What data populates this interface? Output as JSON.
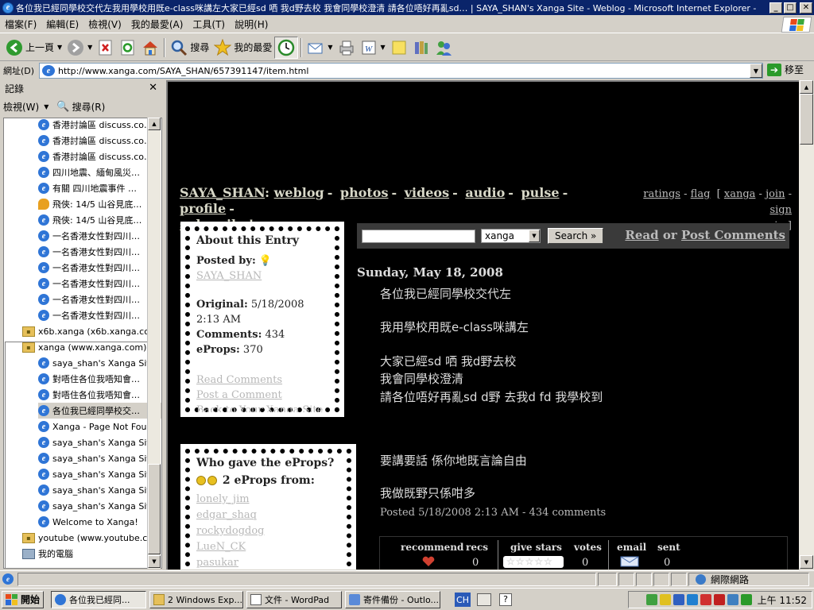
{
  "window": {
    "title": "各位我已經同學校交代左我用學校用既e-class咪講左大家已經sd 哂 我d野去校 我會同學校澄清 請各位唔好再亂sd… | SAYA_SHAN's Xanga Site - Weblog - Microsoft Internet Explorer -",
    "min": "_",
    "max": "□",
    "close": "✕"
  },
  "menu": [
    "檔案(F)",
    "編輯(E)",
    "檢視(V)",
    "我的最愛(A)",
    "工具(T)",
    "說明(H)"
  ],
  "toolbar": {
    "back": "上一頁",
    "search": "搜尋",
    "favorites": "我的最愛"
  },
  "address": {
    "label": "網址(D)",
    "url": "http://www.xanga.com/SAYA_SHAN/657391147/item.html",
    "go": "移至"
  },
  "sidebar": {
    "title": "記錄",
    "view": "檢視(W)",
    "search": "搜尋(R)",
    "items": [
      {
        "text": "香港討論區 discuss.co…",
        "icon": "ie"
      },
      {
        "text": "香港討論區 discuss.co…",
        "icon": "ie"
      },
      {
        "text": "香港討論區 discuss.co…",
        "icon": "ie"
      },
      {
        "text": "四川地震、緬甸風災…",
        "icon": "ie"
      },
      {
        "text": "有關 四川地震事件 …",
        "icon": "ie"
      },
      {
        "text": "飛俠: 14/5 山谷見底…",
        "icon": "chat"
      },
      {
        "text": "飛俠: 14/5 山谷見底…",
        "icon": "ie"
      },
      {
        "text": "一名香港女性對四川…",
        "icon": "ie"
      },
      {
        "text": "一名香港女性對四川…",
        "icon": "ie"
      },
      {
        "text": "一名香港女性對四川…",
        "icon": "ie"
      },
      {
        "text": "一名香港女性對四川…",
        "icon": "ie"
      },
      {
        "text": "一名香港女性對四川…",
        "icon": "ie"
      },
      {
        "text": "一名香港女性對四川…",
        "icon": "ie"
      }
    ],
    "folder1": "x6b.xanga (x6b.xanga.com)",
    "folder2": "xanga (www.xanga.com)",
    "sub": [
      "saya_shan's Xanga Site",
      "對唔住各位我唔知會…",
      "對唔住各位我唔知會…",
      "各位我已經同學校交…",
      "Xanga - Page Not Found",
      "saya_shan's Xanga Site",
      "saya_shan's Xanga Site",
      "saya_shan's Xanga Site",
      "saya_shan's Xanga Site",
      "saya_shan's Xanga Site",
      "Welcome to Xanga!"
    ],
    "folder3": "youtube (www.youtube.com)",
    "mycomputer": "我的電腦"
  },
  "page": {
    "user": "SAYA_SHAN",
    "nav": [
      "weblog",
      "photos",
      "videos",
      "audio",
      "pulse",
      "profile"
    ],
    "subscribe": "subscribe!",
    "right": {
      "ratings": "ratings",
      "flag": "flag",
      "xanga": "xanga",
      "join": "join",
      "sign": "sign",
      "in": "in"
    },
    "about": {
      "title": "About this Entry",
      "posted_by_label": "Posted by:",
      "posted_by": "SAYA_SHAN",
      "original_label": "Original:",
      "original": "5/18/2008 2:13 AM",
      "comments_label": "Comments:",
      "comments": "434",
      "eprops_label": "eProps:",
      "eprops": "370",
      "links": [
        "Read Comments",
        "Post a Comment",
        "Back to Your Xanga Site"
      ]
    },
    "eprops_box": {
      "title": "Who gave the eProps?",
      "count_text": "2 eProps from:",
      "users": [
        "lonely_jim",
        "edgar_shaq",
        "rockydogdog",
        "LueN_CK",
        "pasukar"
      ]
    },
    "search": {
      "select": "xanga",
      "button": "Search »",
      "read": "Read",
      "or": "or",
      "post": "Post Comments"
    },
    "date": "Sunday, May 18, 2008",
    "lines": [
      "各位我已經同學校交代左",
      "我用學校用既e-class咪講左",
      "大家已經sd 哂 我d野去校",
      "我會同學校澄清",
      "請各位唔好再亂sd d野 去我d fd 我學校到",
      "要講要話 係你地既言論自由",
      "我做既野只係咁多"
    ],
    "posted": "Posted 5/18/2008 2:13 AM - 434 comments",
    "rate": {
      "recommend": "recommend",
      "recs": "recs",
      "recs_val": "0",
      "give": "give stars",
      "votes": "votes",
      "votes_val": "0",
      "email": "email",
      "sent": "sent",
      "sent_val": "0"
    }
  },
  "status": {
    "zone": "網際網路"
  },
  "taskbar": {
    "start": "開始",
    "buttons": [
      "各位我已經同...",
      "2 Windows Exp...",
      "文件 - WordPad",
      "寄件備份 - Outlo..."
    ],
    "lang": "CH",
    "clock": "上午 11:52"
  }
}
